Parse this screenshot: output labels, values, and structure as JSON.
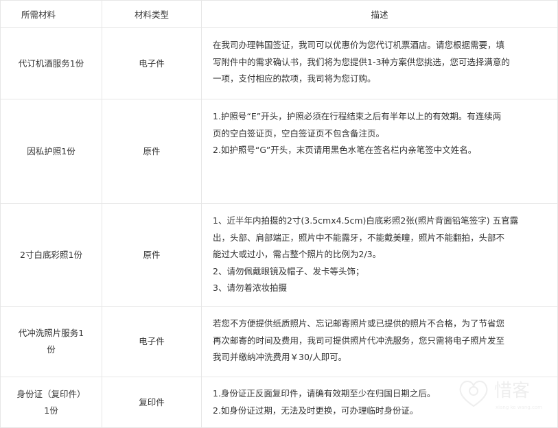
{
  "table": {
    "headers": {
      "name": "所需材料",
      "type": "材料类型",
      "desc": "描述"
    },
    "rows": [
      {
        "name": "代订机酒服务1份",
        "type": "电子件",
        "desc": [
          "在我司办理韩国签证，我司可以优惠价为您代订机票酒店。请您根据需要，填",
          "写附件中的需求确认书，我们将为您提供1-3种方案供您挑选，您可选择满意的",
          "一项，支付相应的款项，我司将为您订购。"
        ]
      },
      {
        "name": "因私护照1份",
        "type": "原件",
        "desc": [
          "1.护照号“E”开头，护照必须在行程结束之后有半年以上的有效期。有连续两",
          "页的空白签证页，空白签证页不包含备注页。",
          "2.如护照号“G”开头，末页请用黑色水笔在签名栏内亲笔签中文姓名。"
        ]
      },
      {
        "name": "2寸白底彩照1份",
        "type": "原件",
        "desc": [
          "1、近半年内拍摄的2寸(3.5cmx4.5cm)白底彩照2张(照片背面铅笔签字) 五官露",
          "出，头部、肩部端正，照片中不能露牙，不能戴美瞳，照片不能翻拍，头部不",
          "能过大或过小，需占整个照片的比例为2/3。",
          "2、请勿佩戴眼镜及帽子、发卡等头饰；",
          "3、请勿着浓妆拍摄"
        ]
      },
      {
        "name_lines": [
          "代冲洗照片服务1",
          "份"
        ],
        "type": "电子件",
        "desc": [
          "若您不方便提供纸质照片、忘记邮寄照片或已提供的照片不合格，为了节省您",
          "再次邮寄的时间及费用，我司可提供照片代冲洗服务，您只需将电子照片发至",
          "我司并缴纳冲洗费用￥30/人即可。"
        ]
      },
      {
        "name_lines": [
          "身份证（复印件）",
          "1份"
        ],
        "type": "复印件",
        "desc": [
          "1.身份证正反面复印件，请确有效期至少在归国日期之后。",
          "2.如身份证过期，无法及时更换，可办理临时身份证。"
        ]
      }
    ]
  },
  "watermark": {
    "icon": "heart-logo",
    "text": "惜客",
    "subtext": "xiang ke wang.com",
    "color": "#d9d9d9"
  }
}
